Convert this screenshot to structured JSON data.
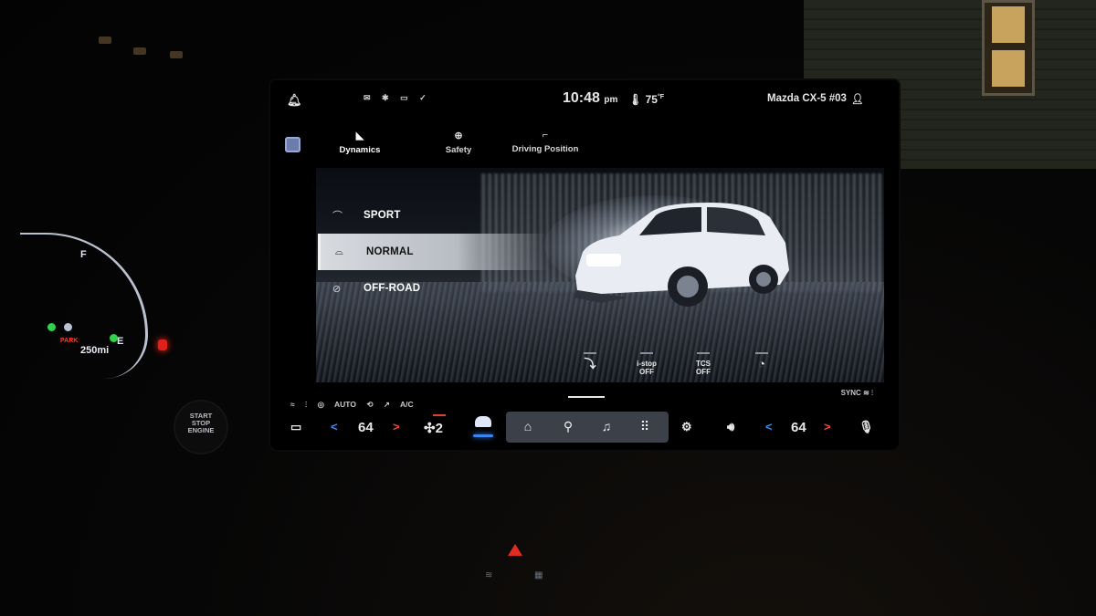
{
  "status_bar": {
    "notifications_icon": "bell-icon",
    "status_icons": [
      "message-icon",
      "bluetooth-icon",
      "phone-battery-icon",
      "check-circle-icon"
    ],
    "time": "10:48",
    "meridiem": "pm",
    "temperature": "75",
    "temperature_unit": "°F",
    "vehicle_name": "Mazda CX-5 #03",
    "profile_icon": "person-icon"
  },
  "tabs": [
    {
      "label": "Dynamics",
      "icon": "dynamics-icon",
      "active": true
    },
    {
      "label": "Safety",
      "icon": "safety-icon",
      "active": false
    },
    {
      "label": "Driving Position",
      "icon": "seat-icon",
      "active": false
    }
  ],
  "drive_modes": [
    {
      "label": "SPORT",
      "icon": "sport-car-icon",
      "selected": false
    },
    {
      "label": "NORMAL",
      "icon": "normal-car-icon",
      "selected": true
    },
    {
      "label": "OFF-ROAD",
      "icon": "offroad-icon",
      "selected": false
    }
  ],
  "quick_toggles": [
    {
      "line1": "",
      "line2": "",
      "icon": "hill-descent-icon",
      "active": true
    },
    {
      "line1": "i-stop",
      "line2": "OFF",
      "icon": "",
      "active": false
    },
    {
      "line1": "TCS",
      "line2": "OFF",
      "icon": "",
      "active": false
    },
    {
      "line1": "",
      "line2": "",
      "icon": "speed-limiter-icon",
      "active": false
    }
  ],
  "climate": {
    "top_labels": [
      "AUTO",
      "A/C"
    ],
    "top_icons": [
      "defrost-rear-icon",
      "seat-heat-icon",
      "steering-heat-icon",
      "recirc-icon",
      "airflow-icon"
    ],
    "sync_label": "SYNC",
    "driver_temp": "64",
    "passenger_temp": "64",
    "fan_level": "2",
    "prev_glyph": "<",
    "next_glyph": ">"
  },
  "dock": [
    "home-icon",
    "map-pin-icon",
    "music-icon",
    "apps-grid-icon"
  ],
  "bottom_icons": {
    "left": "camera-icon",
    "settings": "gear-icon",
    "volume": "volume-icon",
    "voice": "microphone-icon"
  },
  "cluster": {
    "fuel_full": "F",
    "fuel_empty": "E",
    "park_label": "PARK",
    "range": "250mi"
  },
  "engine_button": {
    "line1": "START",
    "line2": "STOP",
    "line3": "ENGINE"
  },
  "colors": {
    "accent_blue": "#3f8ff0",
    "accent_red": "#f04a3a",
    "hazard_red": "#e02c20"
  }
}
